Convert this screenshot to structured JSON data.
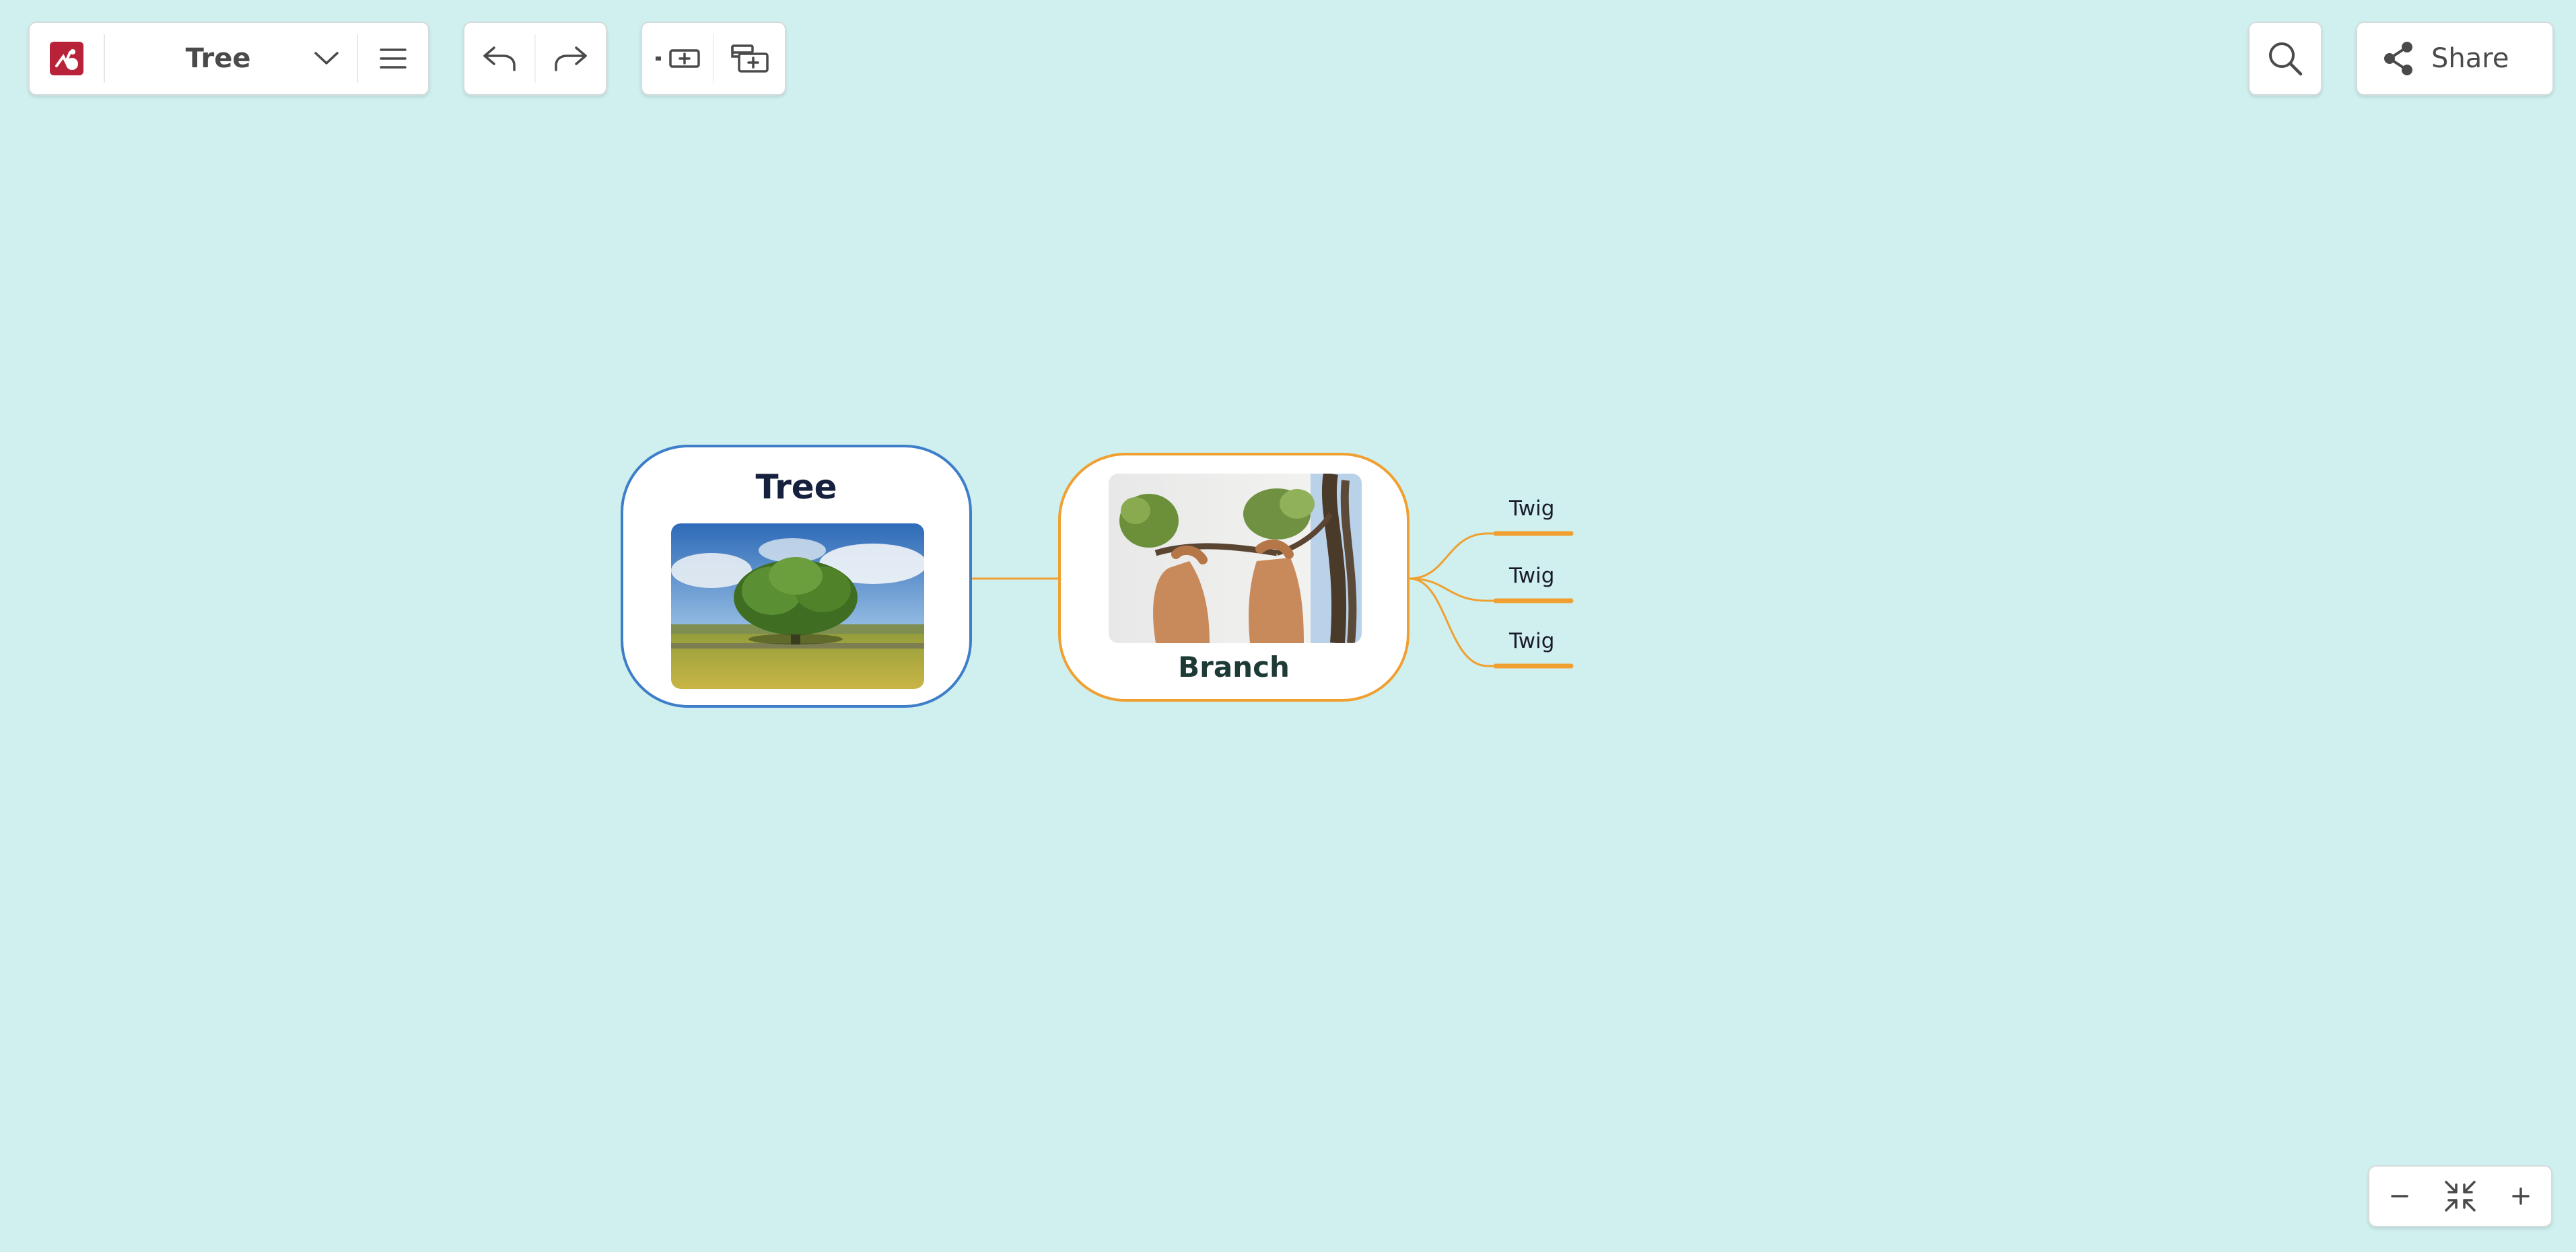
{
  "toolbar": {
    "logo_icon": "app-logo-icon",
    "map_title": "Tree",
    "share_label": "Share"
  },
  "map": {
    "root": {
      "title": "Tree",
      "border_color": "#3e7ec9",
      "image": "tree-photo"
    },
    "branch": {
      "title": "Branch",
      "border_color": "#f0a030",
      "image": "hands-holding-branch-photo"
    },
    "twigs": [
      "Twig",
      "Twig",
      "Twig"
    ]
  },
  "colors": {
    "background": "#cff0ef",
    "accent_orange": "#f0a030",
    "accent_blue": "#3e7ec9",
    "logo_red": "#b8233a"
  }
}
